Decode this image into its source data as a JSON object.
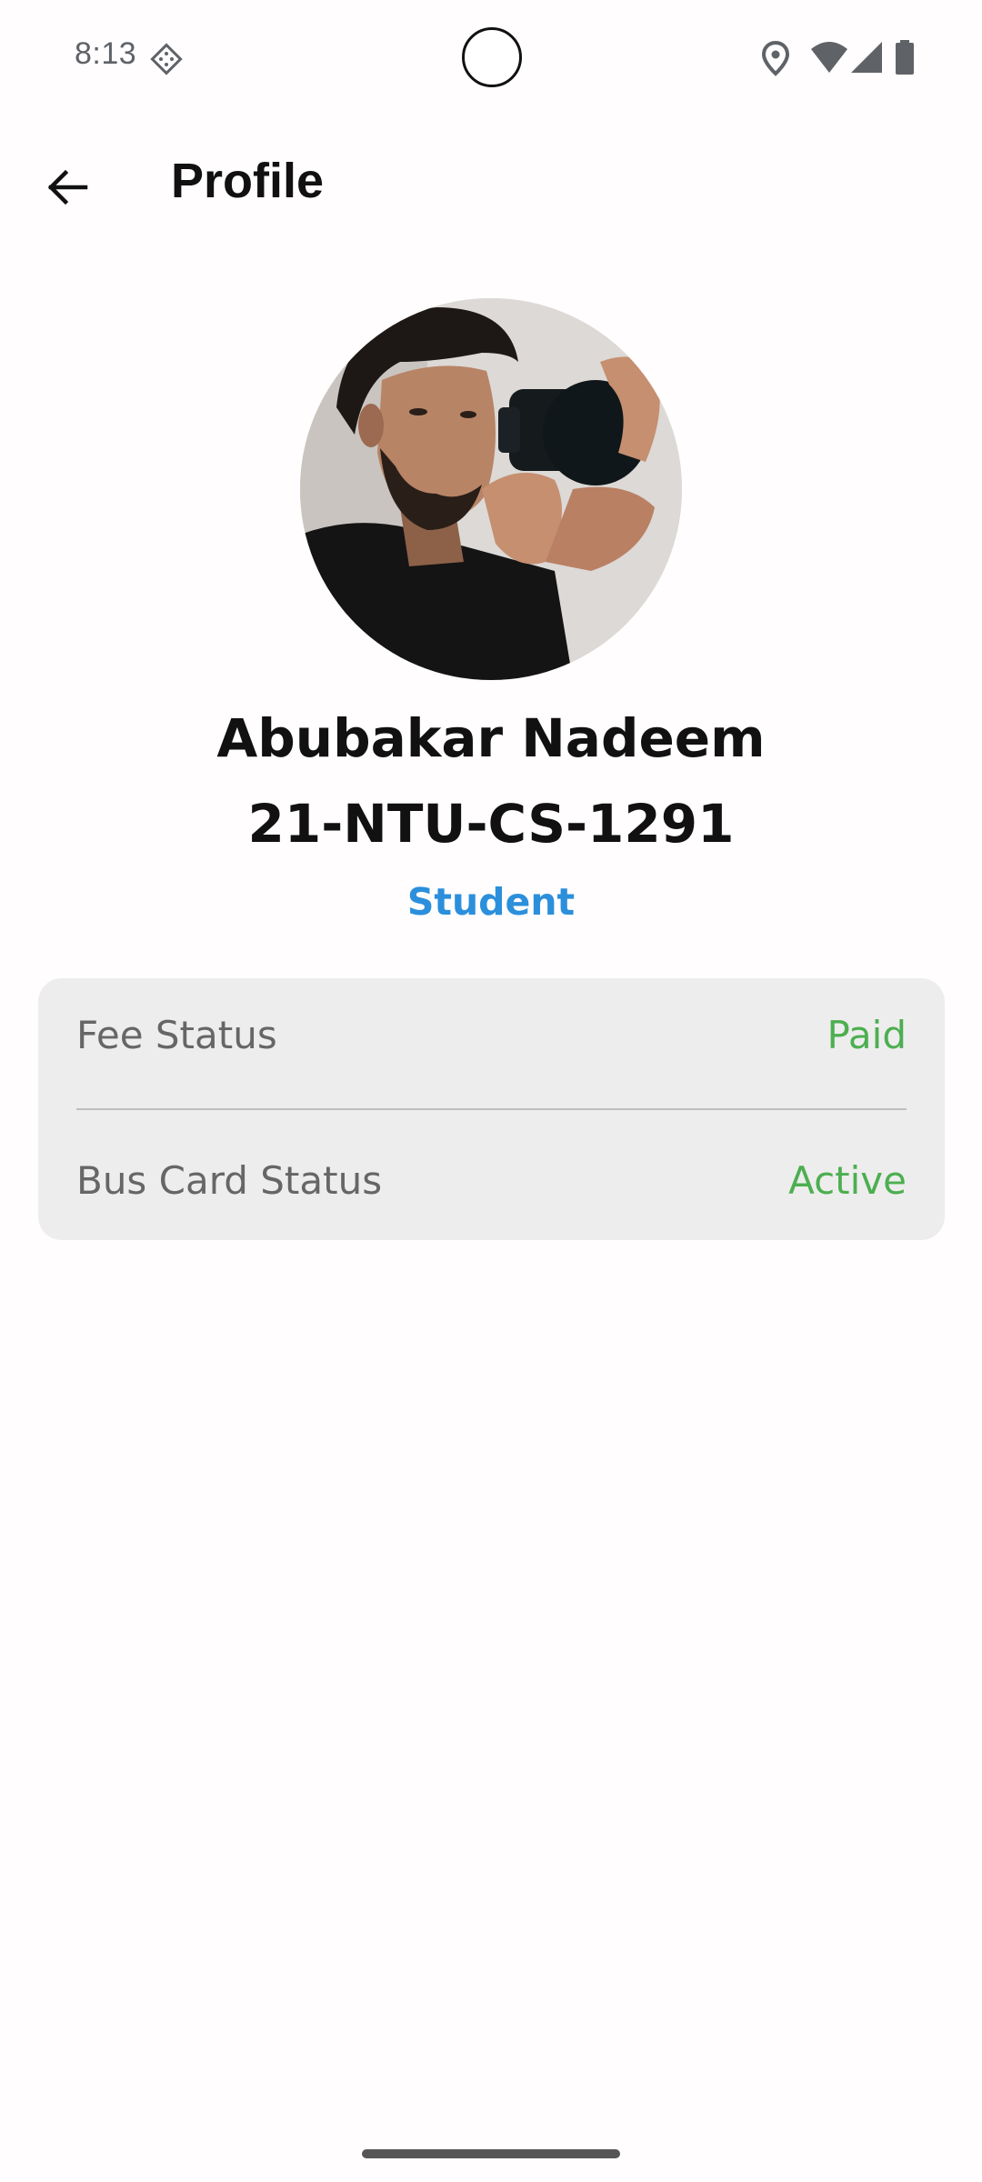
{
  "status_bar": {
    "time": "8:13",
    "icons": [
      "notification-diamond-icon",
      "location-icon",
      "wifi-icon",
      "signal-icon",
      "battery-icon"
    ]
  },
  "app_bar": {
    "title": "Profile",
    "back_icon": "arrow-left-icon"
  },
  "profile": {
    "name": "Abubakar Nadeem",
    "registration_no": "21-NTU-CS-1291",
    "role": "Student",
    "avatar": "profile-photo"
  },
  "status_card": {
    "rows": [
      {
        "label": "Fee Status",
        "value": "Paid"
      },
      {
        "label": "Bus Card Status",
        "value": "Active"
      }
    ]
  },
  "colors": {
    "background": "#fffdfd",
    "role_accent": "#2b8fdc",
    "status_positive": "#4caf50",
    "card_background": "#eeeded",
    "label_gray": "#666666"
  }
}
